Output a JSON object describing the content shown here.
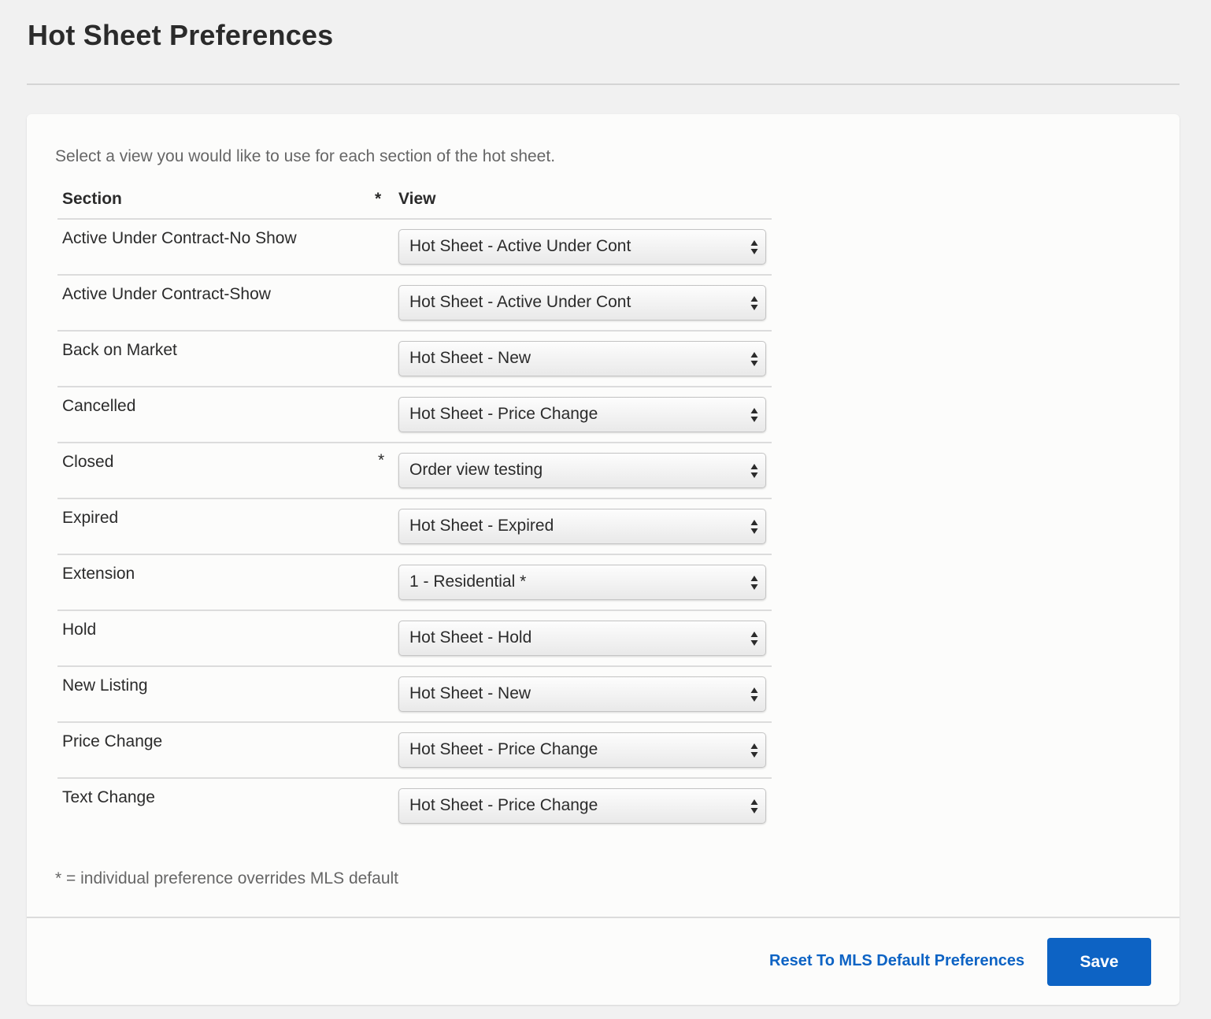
{
  "page": {
    "title": "Hot Sheet Preferences"
  },
  "intro_text": "Select a view you would like to use for each section of the hot sheet.",
  "table": {
    "headers": {
      "section": "Section",
      "override_marker": "*",
      "view": "View"
    },
    "rows": [
      {
        "section": "Active Under Contract-No Show",
        "override": "",
        "view": "Hot Sheet - Active Under Cont"
      },
      {
        "section": "Active Under Contract-Show",
        "override": "",
        "view": "Hot Sheet - Active Under Cont"
      },
      {
        "section": "Back on Market",
        "override": "",
        "view": "Hot Sheet - New"
      },
      {
        "section": "Cancelled",
        "override": "",
        "view": "Hot Sheet - Price Change"
      },
      {
        "section": "Closed",
        "override": "*",
        "view": "Order view testing"
      },
      {
        "section": "Expired",
        "override": "",
        "view": "Hot Sheet - Expired"
      },
      {
        "section": "Extension",
        "override": "",
        "view": "1 - Residential *"
      },
      {
        "section": "Hold",
        "override": "",
        "view": "Hot Sheet - Hold"
      },
      {
        "section": "New Listing",
        "override": "",
        "view": "Hot Sheet - New"
      },
      {
        "section": "Price Change",
        "override": "",
        "view": "Hot Sheet - Price Change"
      },
      {
        "section": "Text Change",
        "override": "",
        "view": "Hot Sheet - Price Change"
      }
    ]
  },
  "footnote": "* = individual preference overrides MLS default",
  "footer": {
    "reset_label": "Reset To MLS Default Preferences",
    "save_label": "Save"
  },
  "colors": {
    "accent": "#0d63c4",
    "background": "#f1f1f1",
    "card": "#fcfcfb"
  },
  "icons": {
    "select_arrow": "up-down-arrows-icon"
  }
}
